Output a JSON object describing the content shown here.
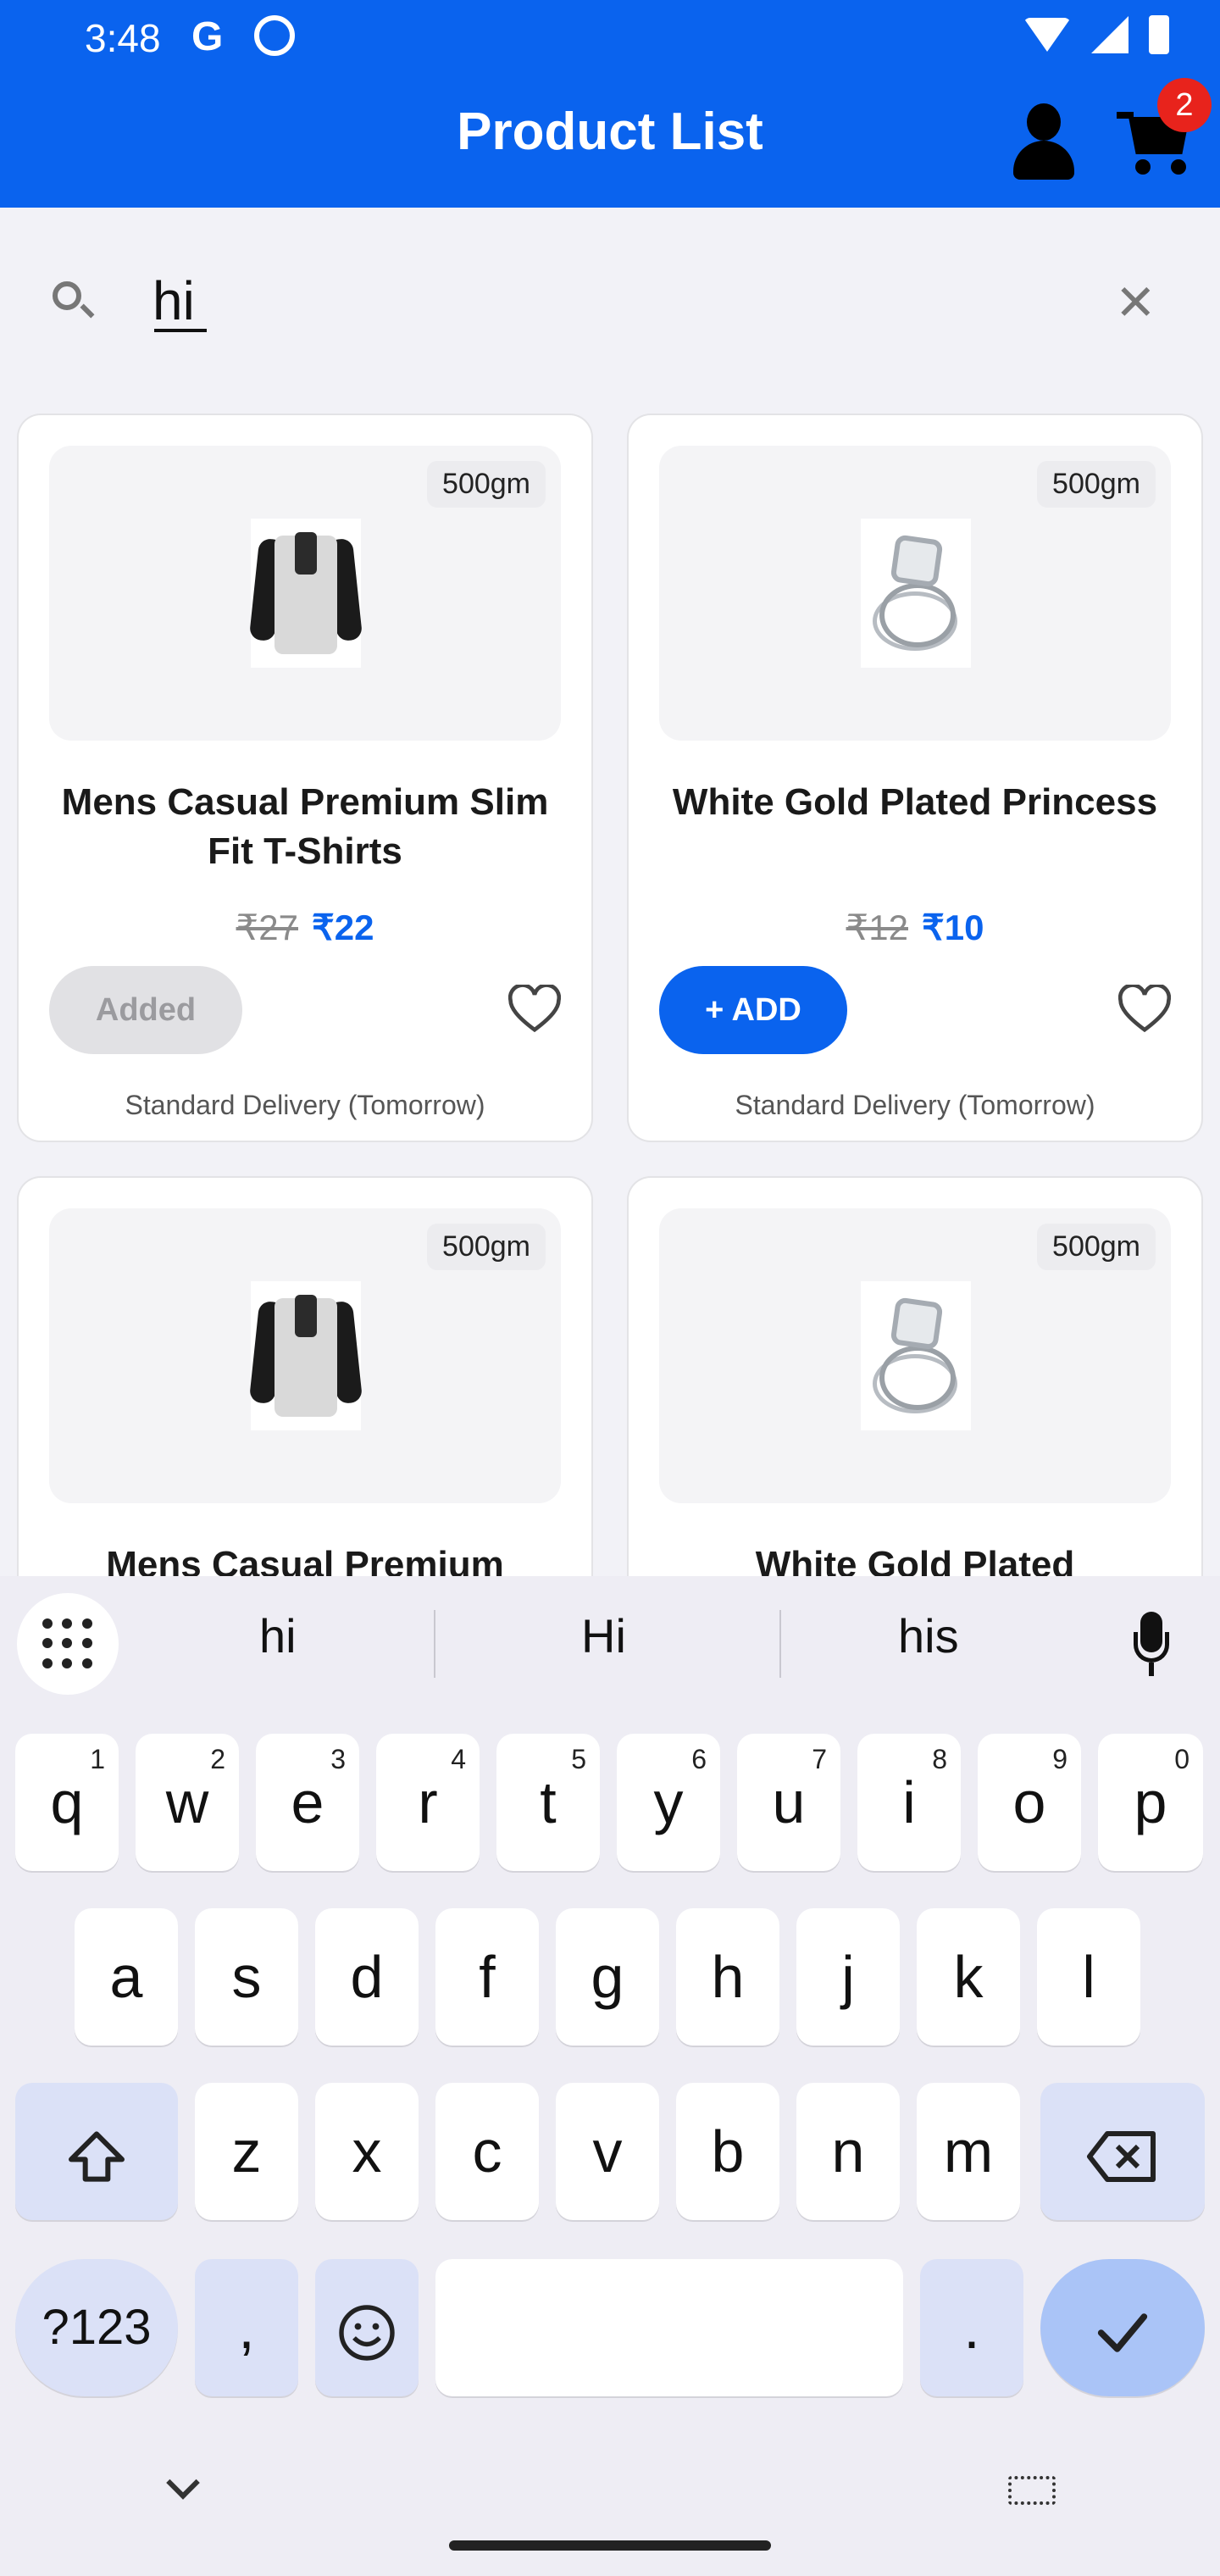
{
  "status_bar": {
    "time": "3:48",
    "g_icon": "G"
  },
  "header": {
    "title": "Product List",
    "cart_count": "2"
  },
  "search": {
    "value": "hi",
    "placeholder": ""
  },
  "products": [
    {
      "weight": "500gm",
      "name": "Mens Casual Premium Slim Fit T-Shirts",
      "old_price": "₹27",
      "new_price": "₹22",
      "button": "Added",
      "delivery": "Standard Delivery (Tomorrow)",
      "image": "tshirt"
    },
    {
      "weight": "500gm",
      "name": "White Gold Plated Princess",
      "old_price": "₹12",
      "new_price": "₹10",
      "button": "+ ADD",
      "delivery": "Standard Delivery (Tomorrow)",
      "image": "ring"
    },
    {
      "weight": "500gm",
      "name": "Mens Casual Premium",
      "image": "tshirt"
    },
    {
      "weight": "500gm",
      "name": "White Gold Plated",
      "image": "ring"
    }
  ],
  "keyboard": {
    "suggestions": [
      "hi",
      "Hi",
      "his"
    ],
    "row1": [
      "q",
      "w",
      "e",
      "r",
      "t",
      "y",
      "u",
      "i",
      "o",
      "p"
    ],
    "row1_nums": [
      "1",
      "2",
      "3",
      "4",
      "5",
      "6",
      "7",
      "8",
      "9",
      "0"
    ],
    "row2": [
      "a",
      "s",
      "d",
      "f",
      "g",
      "h",
      "j",
      "k",
      "l"
    ],
    "row3": [
      "z",
      "x",
      "c",
      "v",
      "b",
      "n",
      "m"
    ],
    "symbols_label": "?123",
    "comma": ",",
    "period": "."
  },
  "colors": {
    "primary": "#0a63ee",
    "badge": "#e8231c"
  }
}
